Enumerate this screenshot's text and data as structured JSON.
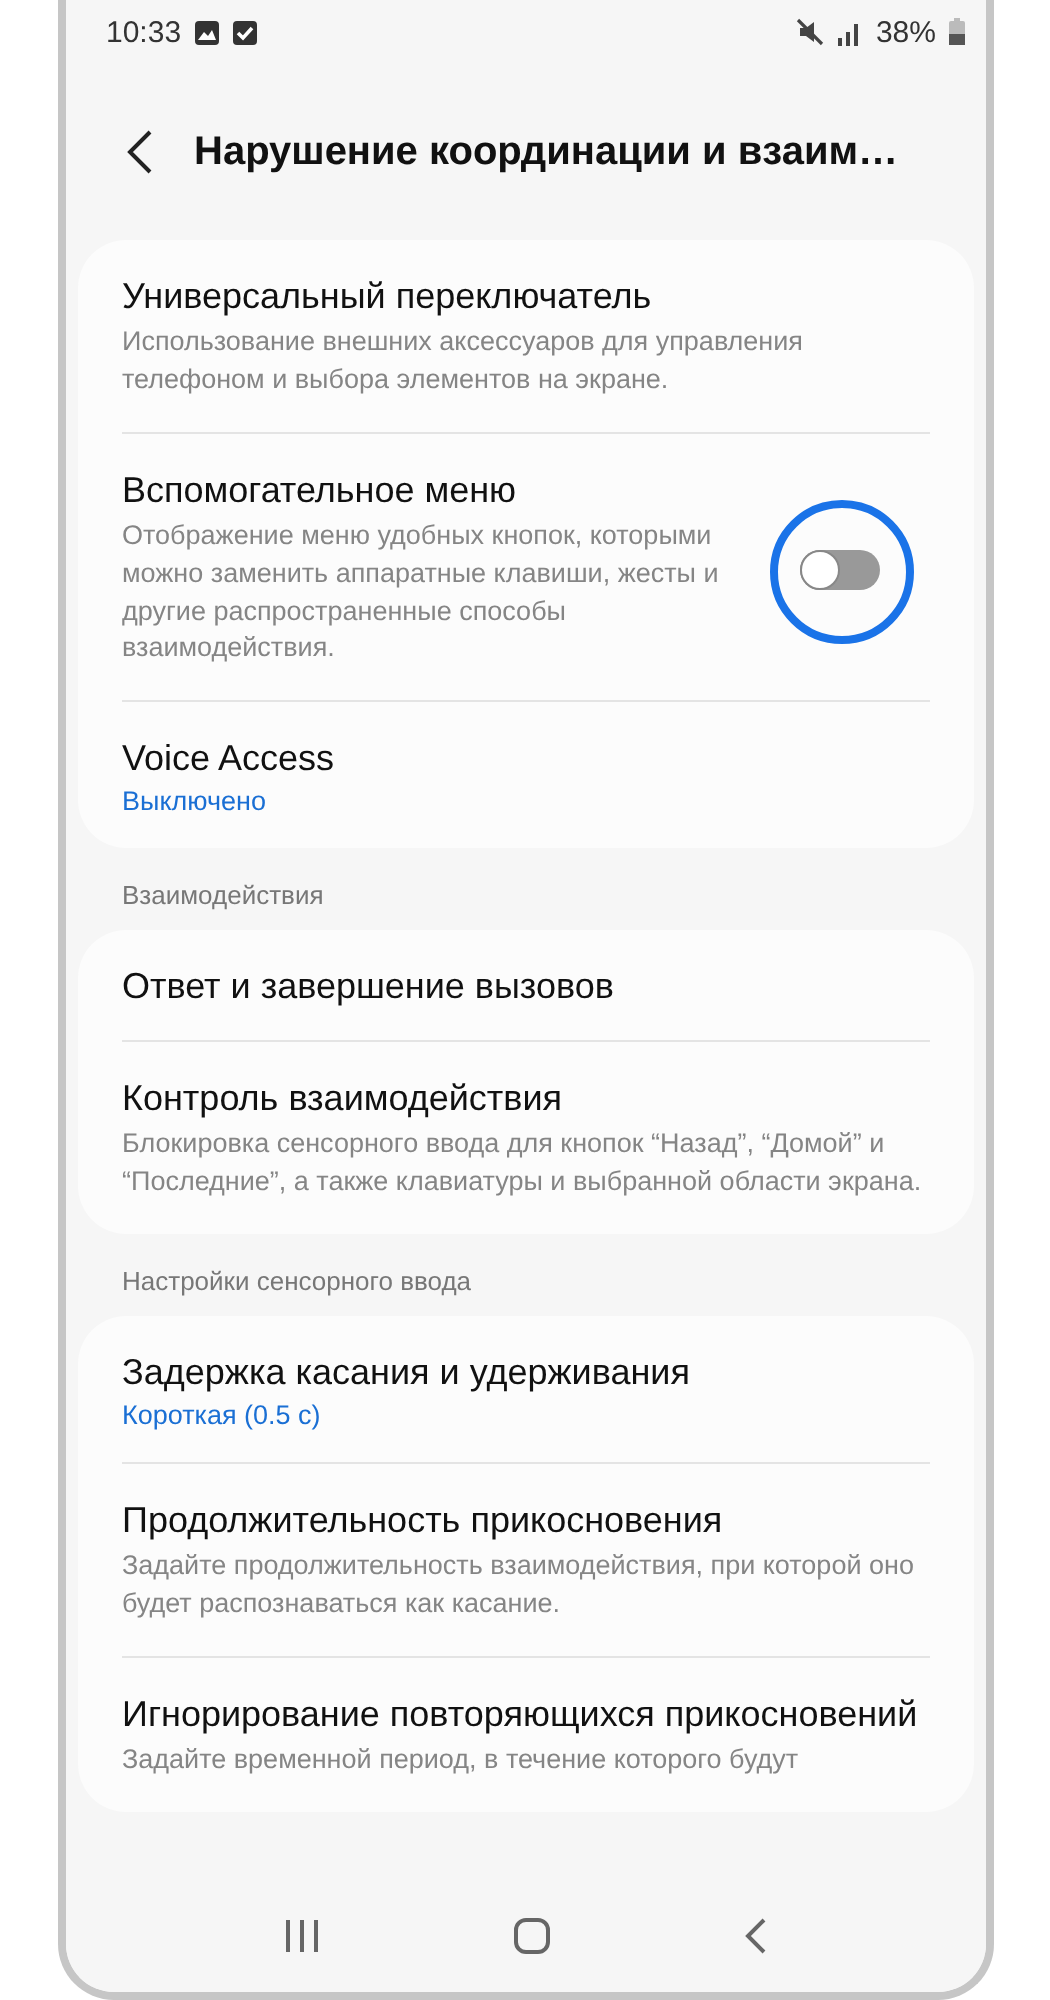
{
  "status_bar": {
    "time": "10:33",
    "battery": "38%"
  },
  "header": {
    "title": "Нарушение координации и взаим…"
  },
  "sections": [
    {
      "items": [
        {
          "kind": "plain",
          "title": "Универсальный переключатель",
          "description": "Использование внешних аксессуаров для управления телефоном и выбора элементов на экране."
        },
        {
          "kind": "toggle",
          "title": "Вспомогательное меню",
          "description": "Отображение меню удобных кнопок, которыми можно заменить аппаратные клавиши, жесты и другие распространенные способы взаимодействия.",
          "on": false,
          "highlighted": true
        },
        {
          "kind": "plain",
          "title": "Voice Access",
          "value": "Выключено"
        }
      ]
    },
    {
      "header": "Взаимодействия",
      "items": [
        {
          "kind": "plain",
          "title": "Ответ и завершение вызовов"
        },
        {
          "kind": "plain",
          "title": "Контроль взаимодействия",
          "description": "Блокировка сенсорного ввода для кнопок “Назад”, “Домой” и “Последние”, а также клавиатуры и выбранной области экрана."
        }
      ]
    },
    {
      "header": "Настройки сенсорного ввода",
      "items": [
        {
          "kind": "plain",
          "title": "Задержка касания и удерживания",
          "value": "Короткая (0.5 с)"
        },
        {
          "kind": "plain",
          "title": "Продолжительность прикосновения",
          "description": "Задайте продолжительность взаимодействия, при которой оно будет распознаваться как касание."
        },
        {
          "kind": "plain",
          "title": "Игнорирование повторяющихся прикосновений",
          "description": "Задайте временной период, в течение которого будут"
        }
      ]
    }
  ]
}
